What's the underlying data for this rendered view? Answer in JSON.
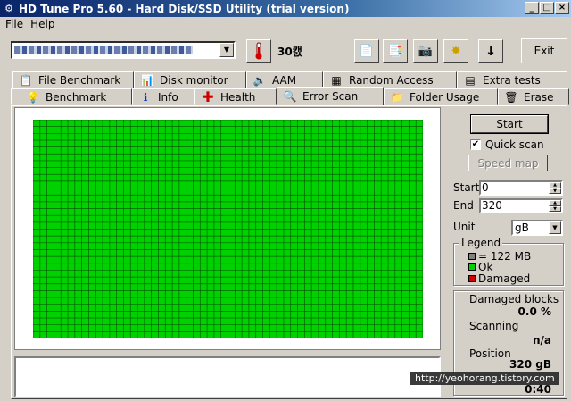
{
  "window": {
    "title": "HD Tune Pro 5.60 - Hard Disk/SSD Utility (trial version)"
  },
  "menu": {
    "file": "File",
    "help": "Help"
  },
  "toolbar": {
    "temperature": "30캜",
    "exit_label": "Exit"
  },
  "tabs_row1": [
    {
      "label": "File Benchmark",
      "icon": "file-benchmark-icon"
    },
    {
      "label": "Disk monitor",
      "icon": "disk-monitor-icon"
    },
    {
      "label": "AAM",
      "icon": "speaker-icon"
    },
    {
      "label": "Random Access",
      "icon": "random-access-icon"
    },
    {
      "label": "Extra tests",
      "icon": "extra-tests-icon"
    }
  ],
  "tabs_row2": [
    {
      "label": "Benchmark",
      "icon": "lightbulb-icon"
    },
    {
      "label": "Info",
      "icon": "info-icon"
    },
    {
      "label": "Health",
      "icon": "health-cross-icon"
    },
    {
      "label": "Error Scan",
      "icon": "magnifier-icon",
      "active": true
    },
    {
      "label": "Folder Usage",
      "icon": "folder-icon"
    },
    {
      "label": "Erase",
      "icon": "trash-icon"
    }
  ],
  "scan": {
    "start_label": "Start",
    "quick_scan_label": "Quick scan",
    "quick_scan_checked": true,
    "speed_map_label": "Speed map",
    "start_field_label": "Start",
    "start_value": "0",
    "end_field_label": "End",
    "end_value": "320",
    "unit_label": "Unit",
    "unit_value": "gB",
    "block_status": "ok",
    "ok_color": "#00d200"
  },
  "legend": {
    "title": "Legend",
    "items": [
      {
        "label": "= 122 MB",
        "color": "#808080"
      },
      {
        "label": "Ok",
        "color": "#00d200"
      },
      {
        "label": "Damaged",
        "color": "#d20000"
      }
    ]
  },
  "stats": {
    "damaged_label": "Damaged blocks",
    "damaged_value": "0.0 %",
    "scanning_label": "Scanning",
    "scanning_value": "n/a",
    "position_label": "Position",
    "position_value": "320 gB",
    "elapsed_value": "0:40"
  },
  "watermark": "http://yeohorang.tistory.com"
}
